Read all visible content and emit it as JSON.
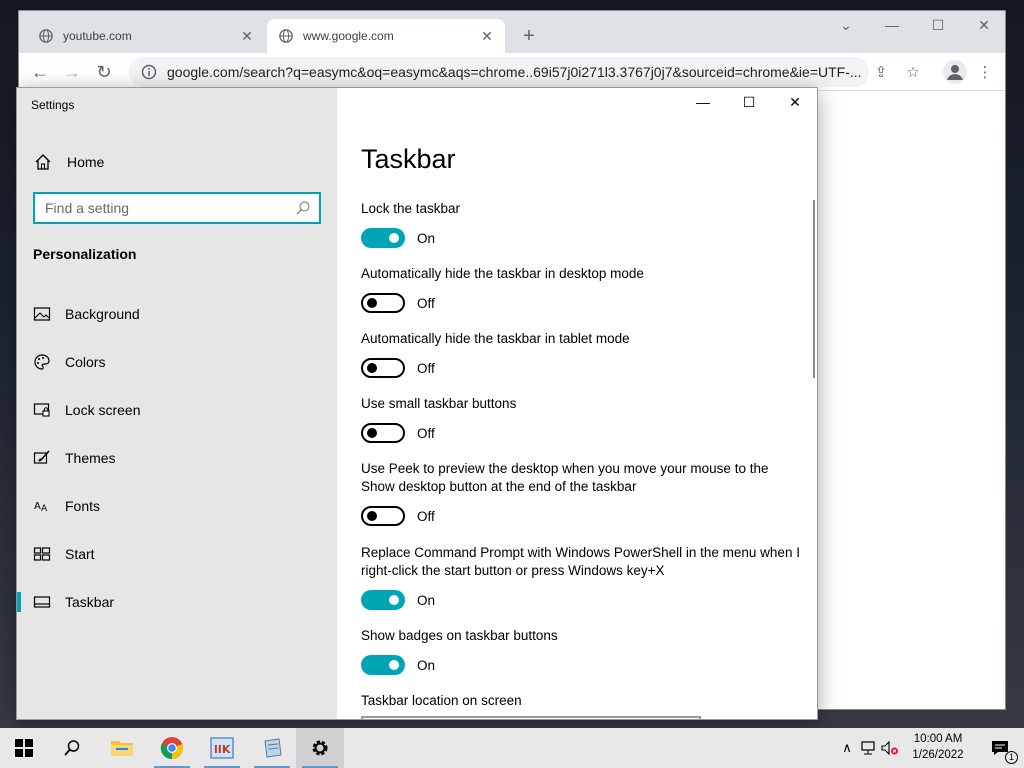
{
  "chrome": {
    "tabs": [
      {
        "title": "youtube.com",
        "close": "✕"
      },
      {
        "title": "www.google.com",
        "close": "✕"
      }
    ],
    "new_tab": "+",
    "url": "google.com/search?q=easymc&oq=easymc&aqs=chrome..69i57j0i271l3.3767j0j7&sourceid=chrome&ie=UTF-..."
  },
  "settings": {
    "app_title": "Settings",
    "home": "Home",
    "search_placeholder": "Find a setting",
    "section": "Personalization",
    "nav": [
      {
        "label": "Background",
        "icon": "picture-icon"
      },
      {
        "label": "Colors",
        "icon": "palette-icon"
      },
      {
        "label": "Lock screen",
        "icon": "lock-screen-icon"
      },
      {
        "label": "Themes",
        "icon": "themes-icon"
      },
      {
        "label": "Fonts",
        "icon": "fonts-icon"
      },
      {
        "label": "Start",
        "icon": "start-icon"
      },
      {
        "label": "Taskbar",
        "icon": "taskbar-icon",
        "selected": true
      }
    ],
    "page_title": "Taskbar",
    "options": [
      {
        "label": "Lock the taskbar",
        "state": "On"
      },
      {
        "label": "Automatically hide the taskbar in desktop mode",
        "state": "Off"
      },
      {
        "label": "Automatically hide the taskbar in tablet mode",
        "state": "Off"
      },
      {
        "label": "Use small taskbar buttons",
        "state": "Off"
      },
      {
        "label": "Use Peek to preview the desktop when you move your mouse to the Show desktop button at the end of the taskbar",
        "state": "Off"
      },
      {
        "label": "Replace Command Prompt with Windows PowerShell in the menu when I right-click the start button or press Windows key+X",
        "state": "On"
      },
      {
        "label": "Show badges on taskbar buttons",
        "state": "On"
      }
    ],
    "location_label": "Taskbar location on screen"
  },
  "taskbar": {
    "time": "10:00 AM",
    "date": "1/26/2022",
    "notification_count": "1"
  },
  "colors": {
    "accent": "#00a5b5",
    "sidebar_bg": "#e6e6e6",
    "taskbar_bg": "#e8e8e8"
  }
}
